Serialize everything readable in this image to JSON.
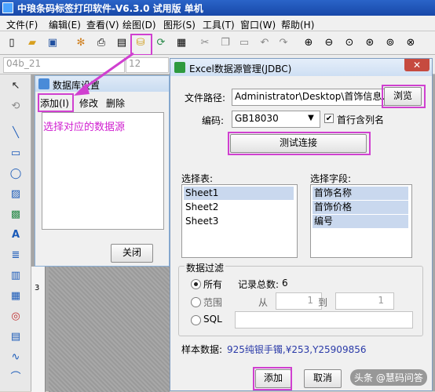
{
  "app": {
    "title": "中琅条码标签打印软件-V6.3.0 试用版 单机"
  },
  "menu": [
    "文件(F)",
    "编辑(E)",
    "查看(V)",
    "绘图(D)",
    "图形(S)",
    "工具(T)",
    "窗口(W)",
    "帮助(H)"
  ],
  "propbar": {
    "font_value": "04b_21",
    "size_value": "12"
  },
  "db_dialog": {
    "title": "数据库设置",
    "add": "添加(I)",
    "edit": "修改",
    "delete": "删除",
    "note": "选择对应的数据源",
    "close": "关闭"
  },
  "excel_dialog": {
    "title": "Excel数据源管理(JDBC)",
    "close": "✕",
    "file_path_label": "文件路径:",
    "file_path_value": "Administrator\\Desktop\\首饰信息.xls",
    "browse": "浏览",
    "encoding_label": "编码:",
    "encoding_value": "GB18030",
    "header_checkbox": "首行含列名",
    "test_connection": "测试连接",
    "select_table_label": "选择表:",
    "tables": [
      "Sheet1",
      "Sheet2",
      "Sheet3"
    ],
    "select_field_label": "选择字段:",
    "fields": [
      "首饰名称",
      "首饰价格",
      "编号"
    ],
    "filter_label": "数据过滤",
    "opt_all": "所有",
    "record_total_label": "记录总数:",
    "record_total_value": "6",
    "opt_range": "范围",
    "from_label": "从",
    "from_value": "1",
    "to_label": "到",
    "to_value": "1",
    "opt_sql": "SQL",
    "sample_label": "样本数据:",
    "sample_value": "925纯银手镯,¥253,Y25909856",
    "add": "添加",
    "cancel": "取消"
  },
  "canvas": {
    "ruler_mark": "3"
  },
  "watermark": "头条 @慧码问答",
  "colors": {
    "highlight": "#d040d0",
    "title_bar": "#2a64c8",
    "sample_text": "#2a3aa8"
  }
}
